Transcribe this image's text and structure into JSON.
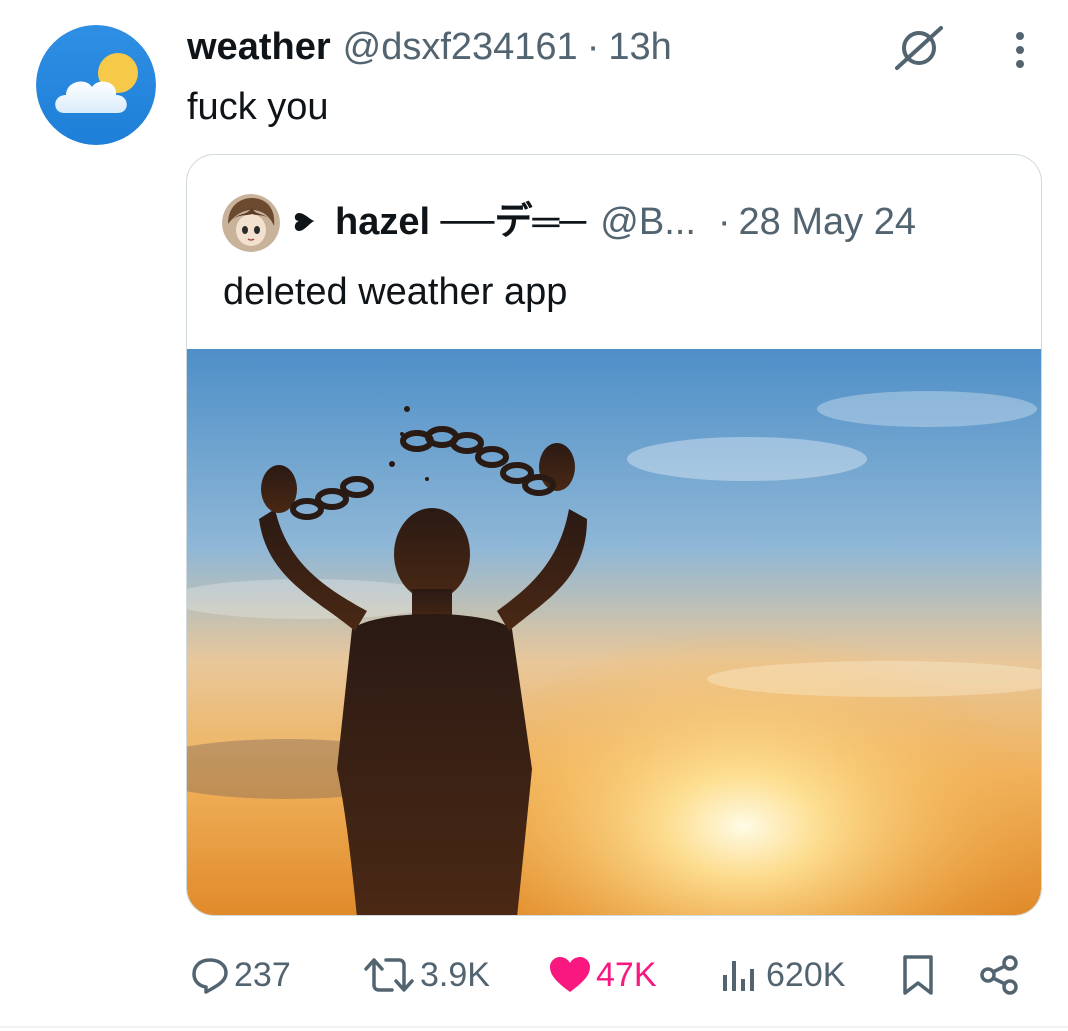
{
  "tweet": {
    "display_name": "weather",
    "handle": "@dsxf234161",
    "separator": "·",
    "time": "13h",
    "text": "fuck you",
    "avatar_icon": "sun-behind-cloud-icon"
  },
  "quote": {
    "name_prefix_icon": "black-heart-suit-icon",
    "display_name": "hazel ──デ═─",
    "handle": "@B...",
    "separator": "·",
    "time": "28 May 24",
    "text": "deleted weather app",
    "image_description_icon": "silhouette-breaking-chains-photo"
  },
  "actions": {
    "replies": "237",
    "reposts": "3.9K",
    "likes": "47K",
    "views": "620K"
  },
  "colors": {
    "text": "#0f1419",
    "secondary": "#536471",
    "like": "#f91880",
    "border": "#cfd9de"
  }
}
